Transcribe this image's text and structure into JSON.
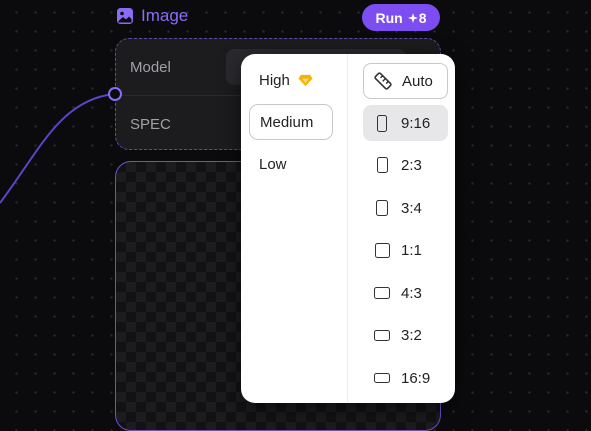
{
  "node": {
    "title": "Image",
    "run_label": "Run",
    "run_cost": "8",
    "rows": {
      "model_label": "Model",
      "spec_label": "SPEC"
    },
    "accent_color": "#8b6cf8",
    "run_color": "#7c4ef2"
  },
  "dropdown": {
    "quality": [
      {
        "label": "High",
        "icon": "gem-icon",
        "icon_color": "#f5b400"
      },
      {
        "label": "Medium",
        "selected": true
      },
      {
        "label": "Low"
      }
    ],
    "aspect_ratios": [
      {
        "label": "Auto",
        "icon": "ruler-icon"
      },
      {
        "label": "9:16",
        "selected": true
      },
      {
        "label": "2:3"
      },
      {
        "label": "3:4"
      },
      {
        "label": "1:1"
      },
      {
        "label": "4:3"
      },
      {
        "label": "3:2"
      },
      {
        "label": "16:9"
      }
    ]
  }
}
